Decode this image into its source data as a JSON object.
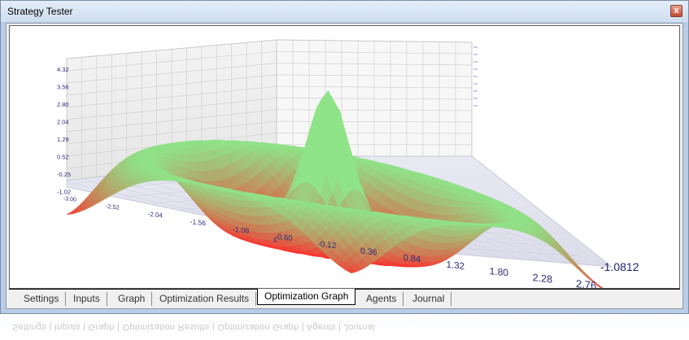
{
  "window": {
    "title": "Strategy Tester",
    "close_glyph": "x"
  },
  "graph": {
    "x_axis_label": "x",
    "x_ticks": [
      "-3.00",
      "-2.52",
      "-2.04",
      "-1.56",
      "-1.08",
      "-0.60",
      "-0.12",
      "0.36",
      "0.84",
      "1.32",
      "1.80",
      "2.28",
      "2.76"
    ],
    "z_ticks": [
      "4.32",
      "3.56",
      "2.80",
      "2.04",
      "1.29",
      "0.52",
      "-0.25",
      "-1.02"
    ],
    "y_end_value": "-1.0812",
    "surface_colors": {
      "high": "#8fe388",
      "low": "#ff2a2a"
    }
  },
  "tabs": [
    {
      "label": "Settings",
      "active": false
    },
    {
      "label": "Inputs",
      "active": false
    },
    {
      "label": "Graph",
      "active": false
    },
    {
      "label": "Optimization Results",
      "active": false
    },
    {
      "label": "Optimization Graph",
      "active": true
    },
    {
      "label": "Agents",
      "active": false
    },
    {
      "label": "Journal",
      "active": false
    }
  ]
}
